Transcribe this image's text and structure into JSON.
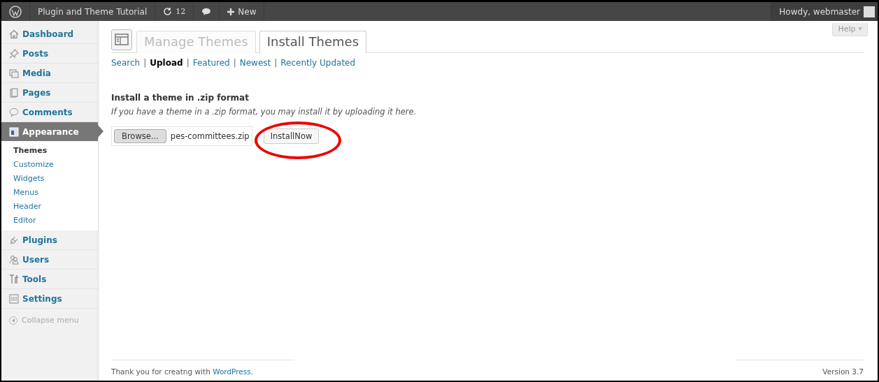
{
  "admin_bar": {
    "site_name": "Plugin and Theme Tutorial",
    "updates_count": "12",
    "new_label": "New",
    "greeting": "Howdy, webmaster"
  },
  "sidebar": {
    "items": [
      {
        "label": "Dashboard",
        "kind": "home",
        "selected": false
      },
      {
        "label": "Posts",
        "kind": "pin",
        "selected": false
      },
      {
        "label": "Media",
        "kind": "media",
        "selected": false
      },
      {
        "label": "Pages",
        "kind": "pages",
        "selected": false
      },
      {
        "label": "Comments",
        "kind": "comment",
        "selected": false
      },
      {
        "label": "Appearance",
        "kind": "appearance",
        "selected": true,
        "children": [
          {
            "label": "Themes",
            "selected": true
          },
          {
            "label": "Customize",
            "selected": false
          },
          {
            "label": "Widgets",
            "selected": false
          },
          {
            "label": "Menus",
            "selected": false
          },
          {
            "label": "Header",
            "selected": false
          },
          {
            "label": "Editor",
            "selected": false
          }
        ]
      },
      {
        "label": "Plugins",
        "kind": "plug",
        "selected": false
      },
      {
        "label": "Users",
        "kind": "users",
        "selected": false
      },
      {
        "label": "Tools",
        "kind": "tools",
        "selected": false
      },
      {
        "label": "Settings",
        "kind": "settings",
        "selected": false
      }
    ],
    "collapse_label": "Collapse menu"
  },
  "help_label": "Help",
  "tabs": [
    {
      "label": "Manage Themes",
      "selected": false
    },
    {
      "label": "Install Themes",
      "selected": true
    }
  ],
  "filters": [
    {
      "label": "Search",
      "selected": false
    },
    {
      "separator": "|",
      "label": "Upload",
      "selected": true
    },
    {
      "separator": "|",
      "label": "Featured",
      "selected": false
    },
    {
      "separator": "|",
      "label": "Newest",
      "selected": false
    },
    {
      "separator": "|",
      "label": "Recently Updated",
      "selected": false
    }
  ],
  "upload": {
    "heading": "Install a theme in .zip format",
    "description": "If you have a theme in a .zip format, you may install it by uploading it here.",
    "browse_label": "Browse...",
    "file_name": "pes-committees.zip",
    "install_label": "InstallNow"
  },
  "footer": {
    "text": "Thank you for creatng with ",
    "link": "WordPress",
    "after": ".",
    "version": "Version 3.7"
  }
}
